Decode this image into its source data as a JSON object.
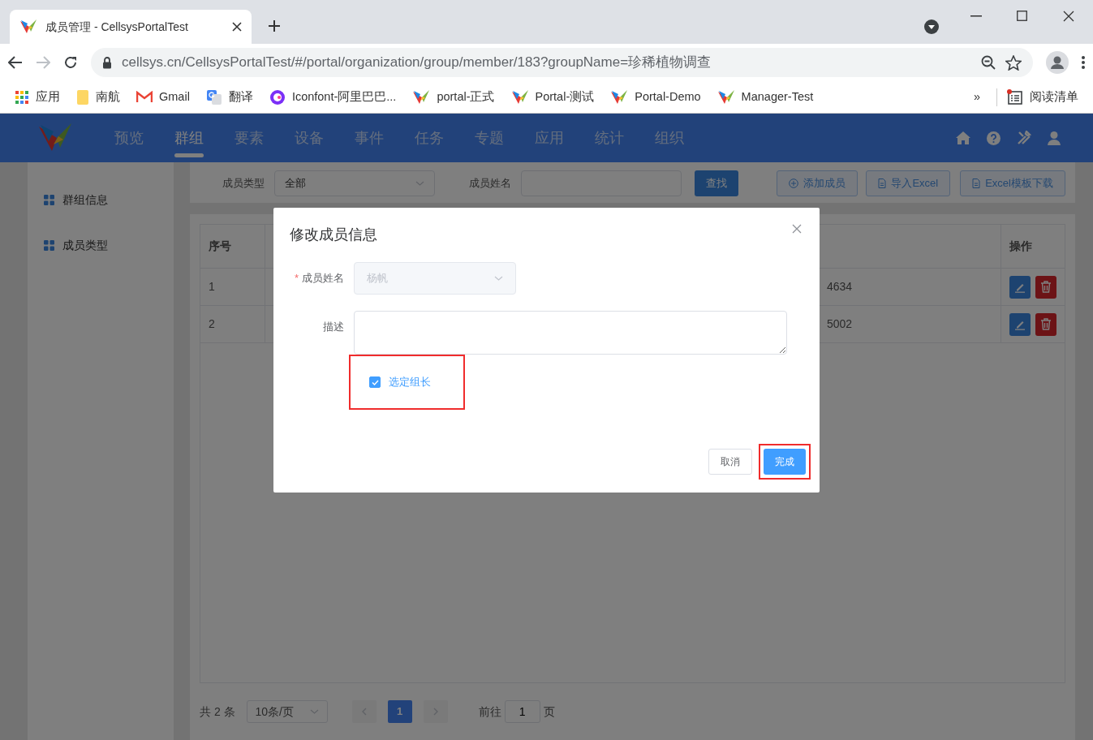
{
  "browser": {
    "tab_title": "成员管理 - CellsysPortalTest",
    "url": "cellsys.cn/CellsysPortalTest/#/portal/organization/group/member/183?groupName=珍稀植物调查",
    "bookmarks": [
      {
        "label": "应用",
        "kind": "apps"
      },
      {
        "label": "南航",
        "kind": "folder"
      },
      {
        "label": "Gmail",
        "kind": "gmail"
      },
      {
        "label": "翻译",
        "kind": "translate"
      },
      {
        "label": "Iconfont-阿里巴巴...",
        "kind": "iconfont"
      },
      {
        "label": "portal-正式",
        "kind": "logo"
      },
      {
        "label": "Portal-测试",
        "kind": "logo"
      },
      {
        "label": "Portal-Demo",
        "kind": "logo"
      },
      {
        "label": "Manager-Test",
        "kind": "logo"
      }
    ],
    "more_bookmarks": "»",
    "reading_list": "阅读清单"
  },
  "nav": {
    "items": [
      {
        "label": "预览",
        "selected": false
      },
      {
        "label": "群组",
        "selected": true
      },
      {
        "label": "要素",
        "selected": false
      },
      {
        "label": "设备",
        "selected": false
      },
      {
        "label": "事件",
        "selected": false
      },
      {
        "label": "任务",
        "selected": false
      },
      {
        "label": "专题",
        "selected": false
      },
      {
        "label": "应用",
        "selected": false
      },
      {
        "label": "统计",
        "selected": false
      },
      {
        "label": "组织",
        "selected": false
      }
    ]
  },
  "sidebar": {
    "items": [
      {
        "label": "群组信息"
      },
      {
        "label": "成员类型"
      }
    ]
  },
  "filter": {
    "type_label": "成员类型",
    "type_value": "全部",
    "name_label": "成员姓名",
    "search_button": "查找",
    "add_button": "添加成员",
    "import_button": "导入Excel",
    "template_button": "Excel模板下载"
  },
  "table": {
    "index_header": "序号",
    "actions_header": "操作",
    "rows": [
      {
        "index": "1",
        "column_3": "4634"
      },
      {
        "index": "2",
        "column_3": "5002"
      }
    ]
  },
  "pagination": {
    "total": "共 2 条",
    "page_size": "10条/页",
    "pages": [
      {
        "label": "1",
        "selected": true
      }
    ],
    "goto_label": "前往",
    "goto_value": "1",
    "page_suffix": "页"
  },
  "dialog": {
    "title": "修改成员信息",
    "name_label": "成员姓名",
    "required_mark": "*",
    "name_value": "杨帆",
    "name_disabled": true,
    "description_label": "描述",
    "leader_checkbox": {
      "label": "选定组长",
      "checked": true,
      "highlighted": true
    },
    "cancel_button": "取消",
    "ok_button": {
      "label": "完成",
      "highlighted": true
    }
  }
}
